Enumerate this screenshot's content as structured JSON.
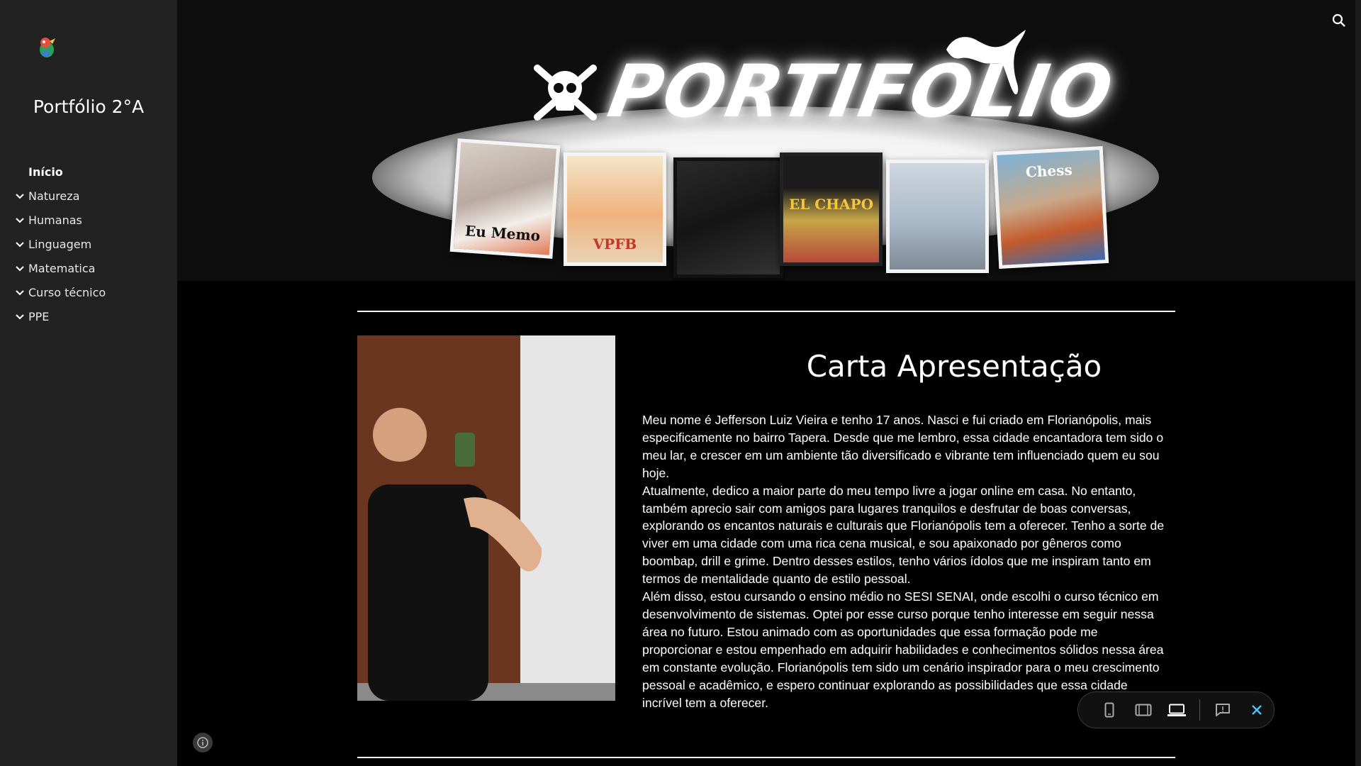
{
  "site": {
    "title": "Portfólio 2°A",
    "logo_icon": "bird-mascot-icon"
  },
  "nav": {
    "items": [
      {
        "label": "Início",
        "active": true,
        "expandable": false
      },
      {
        "label": "Natureza",
        "active": false,
        "expandable": true
      },
      {
        "label": "Humanas",
        "active": false,
        "expandable": true
      },
      {
        "label": "Linguagem",
        "active": false,
        "expandable": true
      },
      {
        "label": "Matematica",
        "active": false,
        "expandable": true
      },
      {
        "label": "Curso técnico",
        "active": false,
        "expandable": true
      },
      {
        "label": "PPE",
        "active": false,
        "expandable": true
      }
    ]
  },
  "banner": {
    "title": "PORTIFOLIO",
    "albums": [
      "Eu Memo",
      "VPFB",
      "",
      "EL CHAPO",
      "",
      "Chess"
    ]
  },
  "content": {
    "title": "Carta Apresentação",
    "paragraphs": [
      "Meu nome é Jefferson Luiz Vieira e tenho 17 anos. Nasci e fui criado em Florianópolis, mais especificamente no bairro Tapera. Desde que me lembro, essa cidade encantadora tem sido o meu lar, e crescer em um ambiente tão diversificado e vibrante tem influenciado quem eu sou hoje.",
      "Atualmente, dedico a maior parte do meu tempo livre a jogar online em casa. No entanto, também aprecio sair com amigos para lugares tranquilos e desfrutar de boas conversas, explorando os encantos naturais e culturais que Florianópolis tem a oferecer. Tenho a sorte de viver em uma cidade com uma rica cena musical, e sou apaixonado por gêneros como boombap, drill e grime. Dentro desses estilos, tenho vários ídolos que me inspiram tanto em termos de mentalidade quanto de estilo pessoal.",
      "Além disso, estou cursando o ensino médio no SESI SENAI, onde escolhi o curso técnico em desenvolvimento de sistemas. Optei por esse curso porque tenho interesse em seguir nessa área no futuro. Estou animado com as oportunidades que essa formação pode me proporcionar e estou empenhado em adquirir habilidades e conhecimentos sólidos nessa área em constante evolução. Florianópolis tem sido um cenário inspirador para o meu crescimento pessoal e acadêmico, e espero continuar explorando as possibilidades que essa cidade incrível tem a oferecer."
    ]
  },
  "toolbar": {
    "buttons": [
      "phone-view-icon",
      "tablet-view-icon",
      "laptop-view-icon",
      "report-icon",
      "close-icon"
    ],
    "selected": "laptop-view-icon",
    "accent": "#4fc3f7"
  }
}
